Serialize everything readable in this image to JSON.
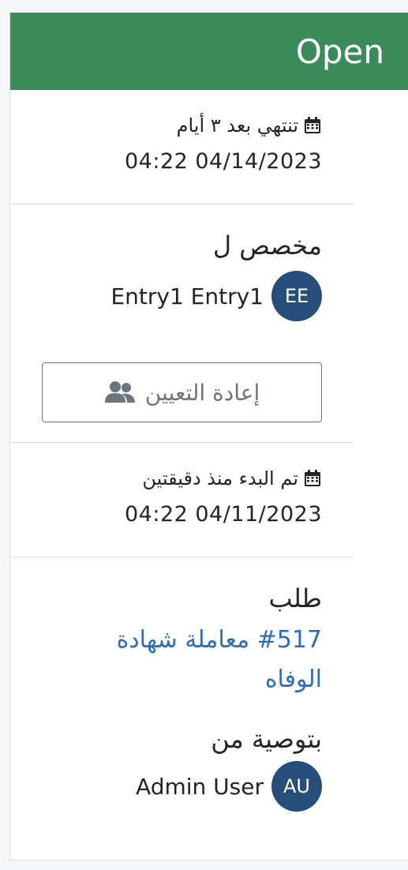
{
  "status": {
    "label": "Open"
  },
  "due": {
    "relative_text": "تنتهي بعد ٣ أيام",
    "datetime": "04:22 04/14/2023"
  },
  "assigned": {
    "heading": "مخصص ل",
    "user": {
      "initials": "EE",
      "name": "Entry1 Entry1"
    },
    "reassign_button_label": "إعادة التعيين"
  },
  "started": {
    "relative_text": "تم البدء منذ دقيقتين",
    "datetime": "04:22 04/11/2023"
  },
  "request": {
    "heading": "طلب",
    "link_text": "#517 معاملة شهادة الوفاه"
  },
  "recommended": {
    "heading": "بتوصية من",
    "user": {
      "initials": "AU",
      "name": "Admin User"
    }
  },
  "colors": {
    "header_bg": "#3b8a5a",
    "avatar_bg": "#274d7a",
    "link": "#2f6db5"
  },
  "icons": [
    "calendar-icon",
    "users-icon"
  ]
}
